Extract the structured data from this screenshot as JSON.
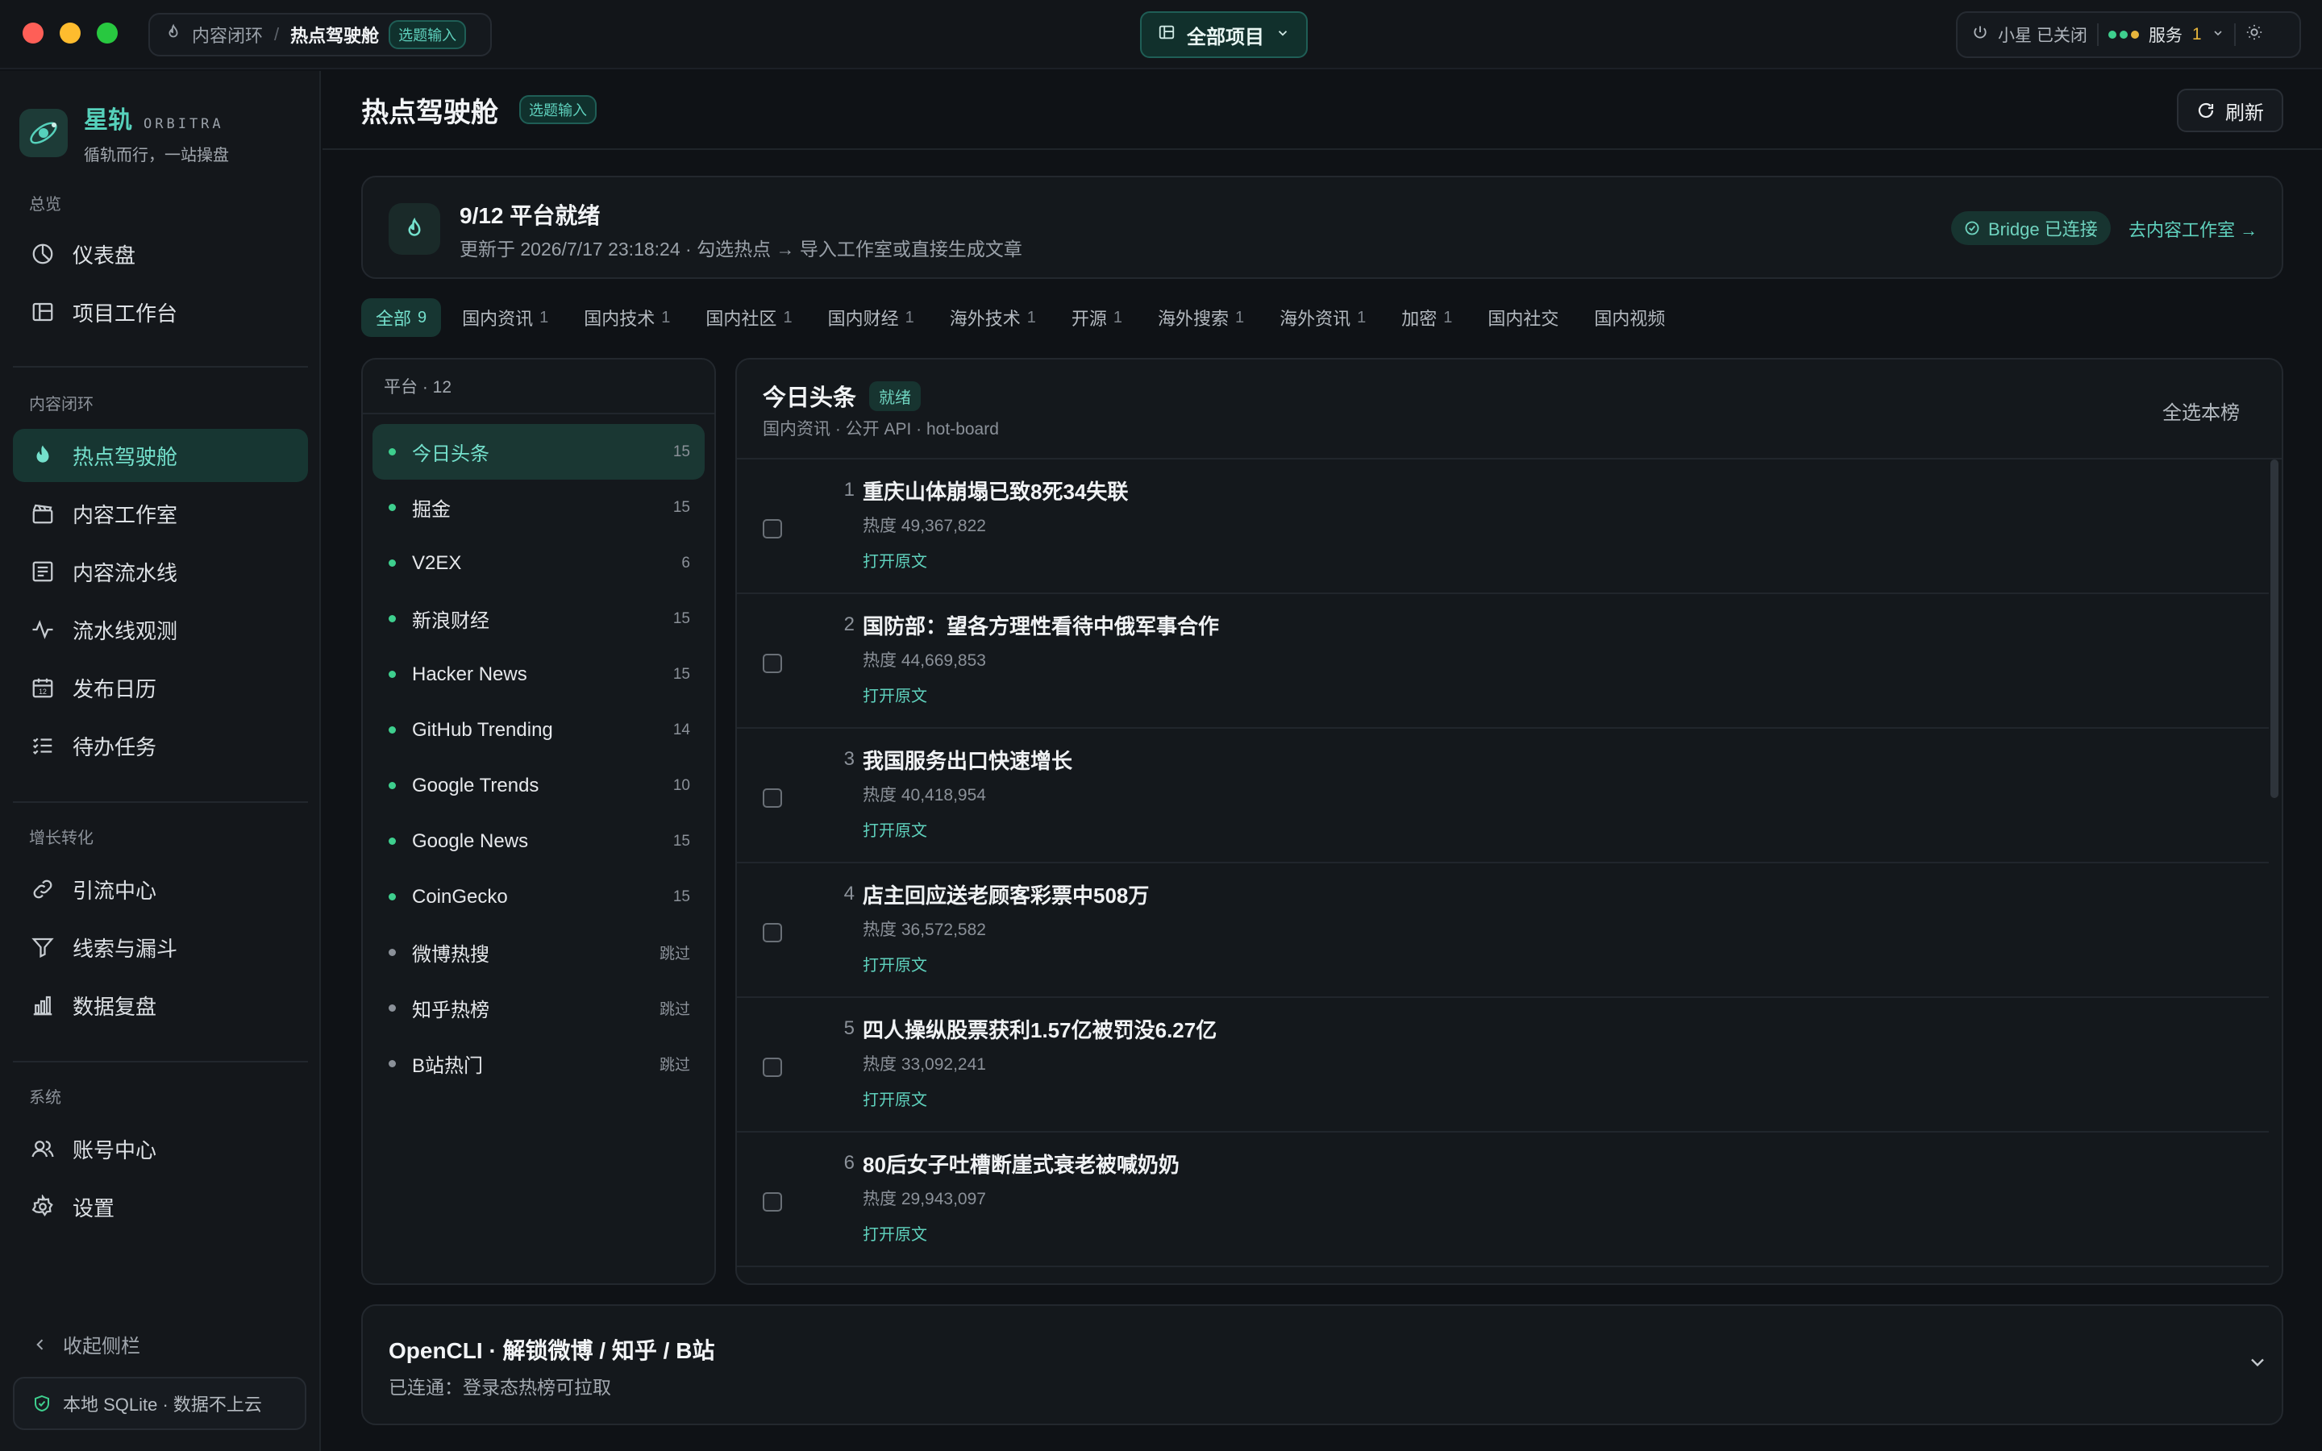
{
  "titlebar": {
    "breadcrumb": [
      "内容闭环",
      "热点驾驶舱"
    ],
    "breadcrumb_badge": "选题输入",
    "project_select": "全部项目",
    "assistant_status": "小星 已关闭",
    "service_label": "服务",
    "service_count": "1"
  },
  "sidebar": {
    "brand_name": "星轨",
    "brand_en": "ORBITRA",
    "brand_tagline": "循轨而行，一站操盘",
    "groups": [
      {
        "title": "总览",
        "items": [
          {
            "label": "仪表盘",
            "icon": "dashboard-icon"
          },
          {
            "label": "项目工作台",
            "icon": "workspace-icon"
          }
        ]
      },
      {
        "title": "内容闭环",
        "items": [
          {
            "label": "热点驾驶舱",
            "icon": "flame-icon",
            "active": true
          },
          {
            "label": "内容工作室",
            "icon": "clapper-icon"
          },
          {
            "label": "内容流水线",
            "icon": "list-icon"
          },
          {
            "label": "流水线观测",
            "icon": "pulse-icon"
          },
          {
            "label": "发布日历",
            "icon": "calendar-icon"
          },
          {
            "label": "待办任务",
            "icon": "checklist-icon"
          }
        ]
      },
      {
        "title": "增长转化",
        "items": [
          {
            "label": "引流中心",
            "icon": "link-icon"
          },
          {
            "label": "线索与漏斗",
            "icon": "funnel-icon"
          },
          {
            "label": "数据复盘",
            "icon": "bar-chart-icon"
          }
        ]
      },
      {
        "title": "系统",
        "items": [
          {
            "label": "账号中心",
            "icon": "users-icon"
          },
          {
            "label": "设置",
            "icon": "gear-icon"
          }
        ]
      }
    ],
    "collapse_label": "收起侧栏",
    "storage_note": "本地 SQLite · 数据不上云"
  },
  "header": {
    "title": "热点驾驶舱",
    "badge": "选题输入",
    "refresh_label": "刷新"
  },
  "ready": {
    "title": "9/12 平台就绪",
    "subtitle": "更新于 2026/7/17 23:18:24 · 勾选热点 → 导入工作室或直接生成文章",
    "bridge_status": "Bridge 已连接",
    "goto_studio": "去内容工作室 →"
  },
  "tabs": [
    {
      "label": "全部",
      "count": "9",
      "active": true
    },
    {
      "label": "国内资讯",
      "count": "1"
    },
    {
      "label": "国内技术",
      "count": "1"
    },
    {
      "label": "国内社区",
      "count": "1"
    },
    {
      "label": "国内财经",
      "count": "1"
    },
    {
      "label": "海外技术",
      "count": "1"
    },
    {
      "label": "开源",
      "count": "1"
    },
    {
      "label": "海外搜索",
      "count": "1"
    },
    {
      "label": "海外资讯",
      "count": "1"
    },
    {
      "label": "加密",
      "count": "1"
    },
    {
      "label": "国内社交",
      "count": ""
    },
    {
      "label": "国内视频",
      "count": ""
    }
  ],
  "platforms": {
    "header": "平台 · 12",
    "items": [
      {
        "name": "今日头条",
        "count": "15",
        "status": "ok",
        "active": true
      },
      {
        "name": "掘金",
        "count": "15",
        "status": "ok"
      },
      {
        "name": "V2EX",
        "count": "6",
        "status": "ok"
      },
      {
        "name": "新浪财经",
        "count": "15",
        "status": "ok"
      },
      {
        "name": "Hacker News",
        "count": "15",
        "status": "ok"
      },
      {
        "name": "GitHub Trending",
        "count": "14",
        "status": "ok"
      },
      {
        "name": "Google Trends",
        "count": "10",
        "status": "ok"
      },
      {
        "name": "Google News",
        "count": "15",
        "status": "ok"
      },
      {
        "name": "CoinGecko",
        "count": "15",
        "status": "ok"
      },
      {
        "name": "微博热搜",
        "count": "跳过",
        "status": "skip"
      },
      {
        "name": "知乎热榜",
        "count": "跳过",
        "status": "skip"
      },
      {
        "name": "B站热门",
        "count": "跳过",
        "status": "skip"
      }
    ]
  },
  "board": {
    "title": "今日头条",
    "status": "就绪",
    "subtitle": "国内资讯 · 公开 API · hot-board",
    "select_all": "全选本榜",
    "open_label": "打开原文",
    "items": [
      {
        "rank": "1",
        "title": "重庆山体崩塌已致8死34失联",
        "heat": "热度 49,367,822"
      },
      {
        "rank": "2",
        "title": "国防部：望各方理性看待中俄军事合作",
        "heat": "热度 44,669,853"
      },
      {
        "rank": "3",
        "title": "我国服务出口快速增长",
        "heat": "热度 40,418,954"
      },
      {
        "rank": "4",
        "title": "店主回应送老顾客彩票中508万",
        "heat": "热度 36,572,582"
      },
      {
        "rank": "5",
        "title": "四人操纵股票获利1.57亿被罚没6.27亿",
        "heat": "热度 33,092,241"
      },
      {
        "rank": "6",
        "title": "80后女子吐槽断崖式衰老被喊奶奶",
        "heat": "热度 29,943,097"
      }
    ]
  },
  "opencli": {
    "title": "OpenCLI · 解锁微博 / 知乎 / B站",
    "subtitle": "已连通：登录态热榜可拉取"
  },
  "colors": {
    "accent": "#5fd1bd",
    "ok_dot": "#3ecf8e",
    "skip_dot": "#8b9199",
    "background": "#0f1216"
  }
}
